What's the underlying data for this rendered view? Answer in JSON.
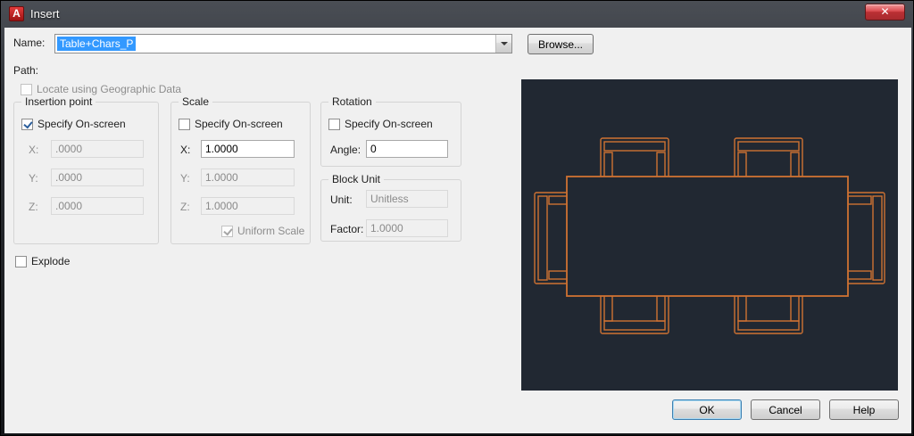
{
  "window": {
    "title": "Insert"
  },
  "header": {
    "name_label": "Name:",
    "name_value": "Table+Chars_P",
    "browse_label": "Browse...",
    "path_label": "Path:",
    "geo_label": "Locate using Geographic Data"
  },
  "insertion_point": {
    "title": "Insertion point",
    "specify_label": "Specify On-screen",
    "x_label": "X:",
    "x_value": ".0000",
    "y_label": "Y:",
    "y_value": ".0000",
    "z_label": "Z:",
    "z_value": ".0000"
  },
  "scale": {
    "title": "Scale",
    "specify_label": "Specify On-screen",
    "x_label": "X:",
    "x_value": "1.0000",
    "y_label": "Y:",
    "y_value": "1.0000",
    "z_label": "Z:",
    "z_value": "1.0000",
    "uniform_label": "Uniform Scale"
  },
  "rotation": {
    "title": "Rotation",
    "specify_label": "Specify On-screen",
    "angle_label": "Angle:",
    "angle_value": "0"
  },
  "block_unit": {
    "title": "Block Unit",
    "unit_label": "Unit:",
    "unit_value": "Unitless",
    "factor_label": "Factor:",
    "factor_value": "1.0000"
  },
  "explode_label": "Explode",
  "footer": {
    "ok_label": "OK",
    "cancel_label": "Cancel",
    "help_label": "Help"
  },
  "colors": {
    "preview_background": "#212832",
    "drawing_stroke": "#cf7232",
    "selection_highlight": "#3399ff",
    "titlebar": "#1b1d20"
  }
}
